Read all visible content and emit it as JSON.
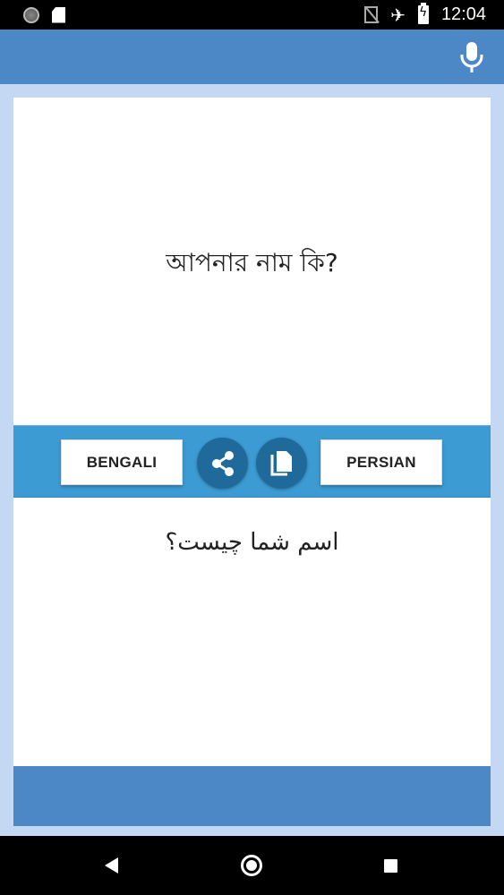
{
  "status_bar": {
    "time": "12:04",
    "icons": [
      "notification-icon",
      "sd-card-icon",
      "no-sim-icon",
      "airplane-icon",
      "battery-charging-icon"
    ]
  },
  "app_bar": {
    "mic_icon": "mic-icon",
    "accent_color": "#4d88c6"
  },
  "translator": {
    "source_text": "আপনার নাম কি?",
    "target_text": "اسم شما چیست؟",
    "source_language": "BENGALI",
    "target_language": "PERSIAN",
    "share_icon": "share-icon",
    "copy_icon": "copy-icon",
    "strip_color": "#3c9bd2",
    "button_color": "#1f6a9a"
  },
  "nav_bar": {
    "icons": [
      "back-icon",
      "home-icon",
      "recents-icon"
    ]
  }
}
